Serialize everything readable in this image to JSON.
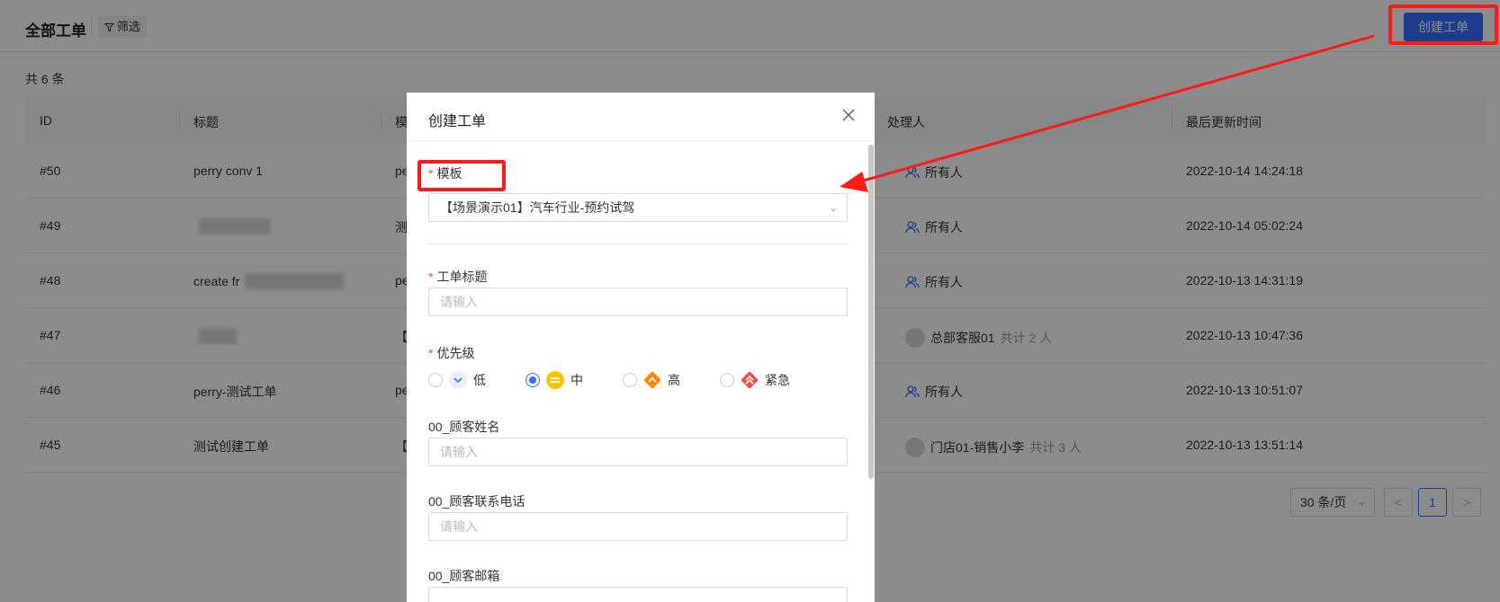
{
  "header": {
    "title": "全部工单",
    "filter_label": "筛选",
    "create_button": "创建工单"
  },
  "total_text": "共 6 条",
  "table": {
    "columns": [
      "ID",
      "标题",
      "模",
      "处理人",
      "最后更新时间"
    ],
    "rows": [
      {
        "id": "#50",
        "title": "perry conv 1",
        "template": "pe",
        "assignee": "所有人",
        "assignee_extra": "",
        "assignee_type": "group",
        "updated": "2022-10-14 14:24:18"
      },
      {
        "id": "#49",
        "title": "",
        "template": "测",
        "assignee": "所有人",
        "assignee_extra": "",
        "assignee_type": "group",
        "updated": "2022-10-14 05:02:24"
      },
      {
        "id": "#48",
        "title": "create fr",
        "template": "pe",
        "assignee": "所有人",
        "assignee_extra": "",
        "assignee_type": "group",
        "updated": "2022-10-13 14:31:19"
      },
      {
        "id": "#47",
        "title": "",
        "template": "【",
        "assignee": "总部客服01",
        "assignee_extra": "共计 2 人",
        "assignee_type": "person",
        "updated": "2022-10-13 10:47:36"
      },
      {
        "id": "#46",
        "title": "perry-测试工单",
        "template": "pe",
        "assignee": "所有人",
        "assignee_extra": "",
        "assignee_type": "group",
        "updated": "2022-10-13 10:51:07"
      },
      {
        "id": "#45",
        "title": "测试创建工单",
        "template": "【",
        "assignee": "门店01-销售小李",
        "assignee_extra": "共计 3 人",
        "assignee_type": "person",
        "updated": "2022-10-13 13:51:14"
      }
    ]
  },
  "pagination": {
    "page_size": "30 条/页",
    "prev": "<",
    "current": "1",
    "next": ">"
  },
  "modal": {
    "title": "创建工单",
    "fields": {
      "template_label": "模板",
      "template_value": "【场景演示01】汽车行业-预约试驾",
      "title_label": "工单标题",
      "title_placeholder": "请输入",
      "priority_label": "优先级",
      "priority_options": [
        "低",
        "中",
        "高",
        "紧急"
      ],
      "priority_selected": "中",
      "customer_name_label": "00_顾客姓名",
      "customer_name_placeholder": "请输入",
      "customer_phone_label": "00_顾客联系电话",
      "customer_phone_placeholder": "请输入",
      "customer_email_label": "00_顾客邮箱"
    }
  },
  "colors": {
    "primary": "#3370ff",
    "annotation": "#ff1a1a",
    "required": "#f54a45",
    "priority_low": "#e8f0ff",
    "priority_mid": "#f7c600",
    "priority_high": "#ff8800",
    "priority_urgent": "#f54a45"
  }
}
